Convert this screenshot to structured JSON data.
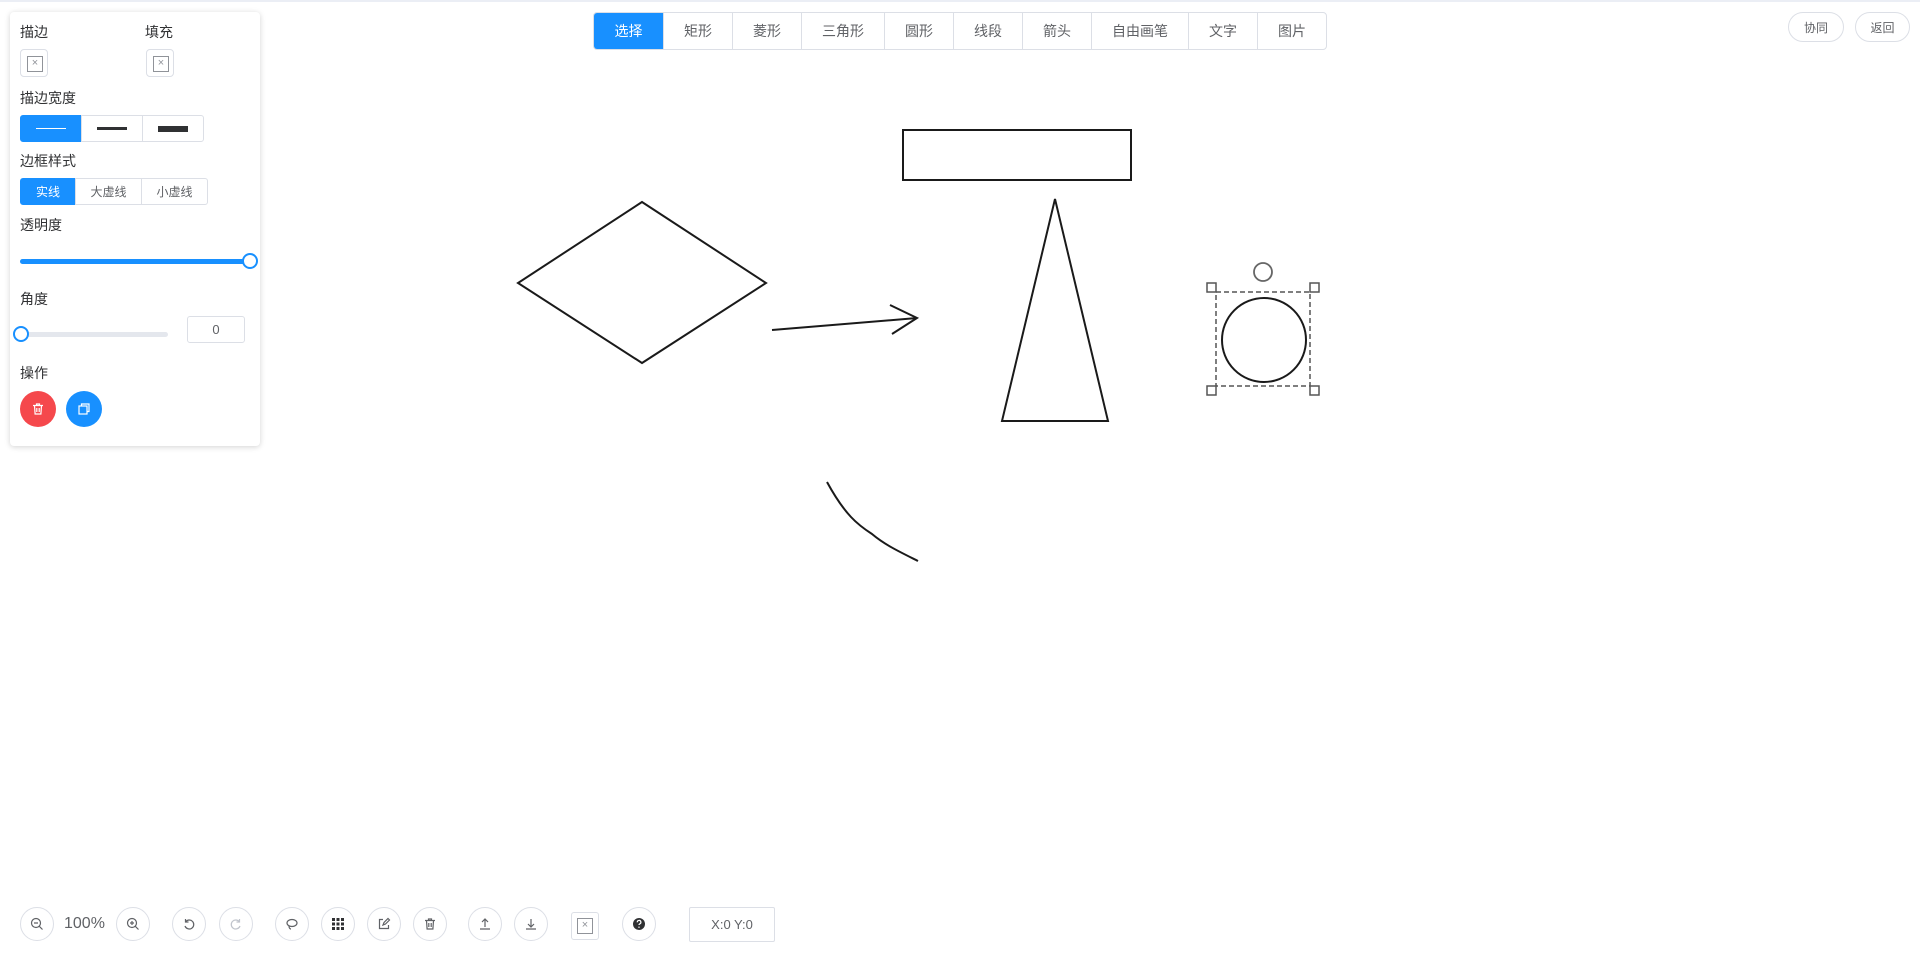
{
  "panel": {
    "stroke_label": "描边",
    "fill_label": "填充",
    "stroke_width_label": "描边宽度",
    "border_style_label": "边框样式",
    "border_styles": [
      "实线",
      "大虚线",
      "小虚线"
    ],
    "opacity_label": "透明度",
    "opacity_value": 1.0,
    "angle_label": "角度",
    "angle_value": "0",
    "actions_label": "操作"
  },
  "toolbar": {
    "tools": [
      "选择",
      "矩形",
      "菱形",
      "三角形",
      "圆形",
      "线段",
      "箭头",
      "自由画笔",
      "文字",
      "图片"
    ],
    "active_tool": "选择"
  },
  "header": {
    "collab_label": "协同",
    "back_label": "返回"
  },
  "bottom": {
    "zoom": "100%",
    "coords": "X:0 Y:0"
  },
  "colors": {
    "accent": "#1890ff",
    "delete": "#f5484c",
    "border": "#dcdfe6"
  }
}
